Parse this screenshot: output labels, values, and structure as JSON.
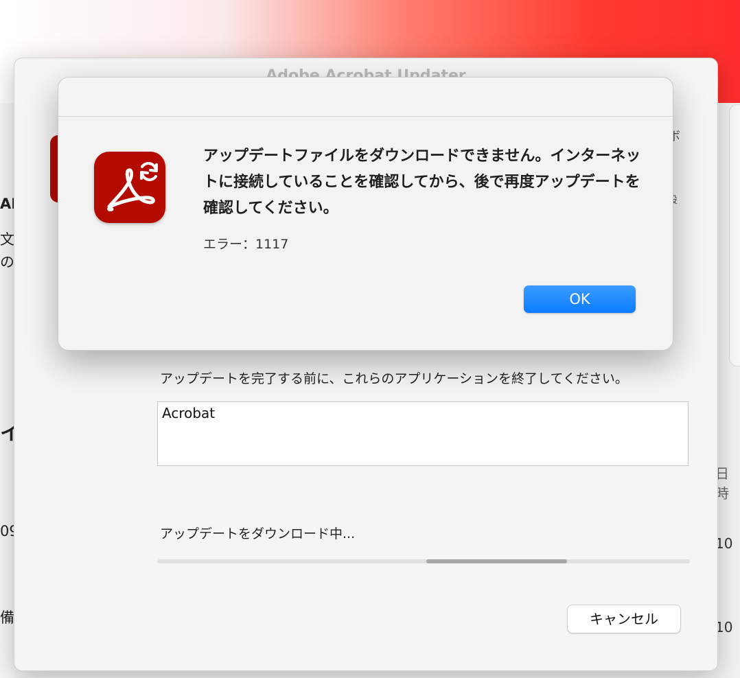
{
  "window": {
    "title": "Adobe Acrobat Updater"
  },
  "alert": {
    "message": "アップデートファイルをダウンロードできません。インターネットに接続していることを確認してから、後で再度アップデートを確認してください。",
    "error_text": "エラー：1117",
    "ok_label": "OK"
  },
  "updater": {
    "close_apps_text": "アップデートを完了する前に、これらのアプリケーションを終了してください。",
    "apps": [
      "Acrobat"
    ],
    "progress_text": "アップデートをダウンロード中...",
    "cancel_label": "キャンセル"
  },
  "background_fragments": {
    "left_1": "AI",
    "left_2": "文書",
    "left_3": "の、",
    "left_4": "イ",
    "left_5": "09",
    "left_6": "備",
    "right_1": "日時",
    "right_2": "10",
    "right_3": "10",
    "side_1": "ボ",
    "side_2": "設"
  },
  "colors": {
    "accent_blue": "#0a7cff",
    "acrobat_red": "#b30b00"
  },
  "icons": {
    "app_icon": "acrobat-update-icon"
  }
}
